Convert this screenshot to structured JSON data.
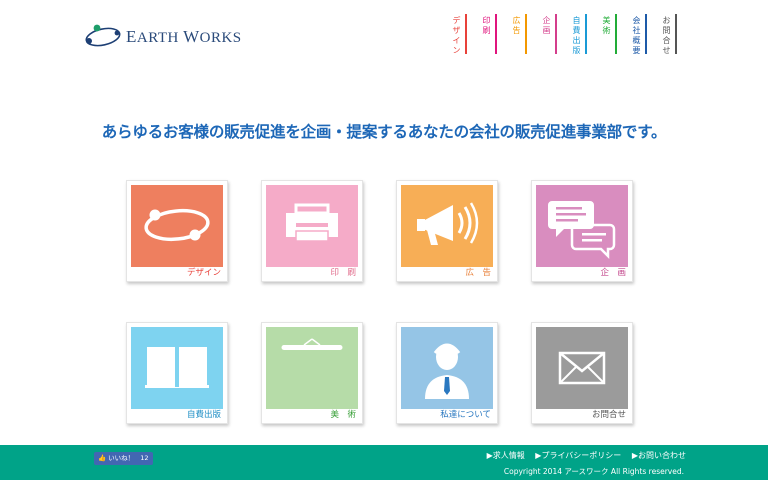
{
  "logo": {
    "big": "E",
    "rest": "ARTH",
    "space": " ",
    "big2": "W",
    "rest2": "ORKS"
  },
  "nav": [
    {
      "label": "デザイン",
      "color": "#e8413a"
    },
    {
      "label": "印刷",
      "color": "#e0157d"
    },
    {
      "label": "広告",
      "color": "#f39800"
    },
    {
      "label": "企画",
      "color": "#d43e8c"
    },
    {
      "label": "自費出版",
      "color": "#1a9ad6"
    },
    {
      "label": "美術",
      "color": "#22ac38"
    },
    {
      "label": "会社概要",
      "color": "#1d5aa8"
    },
    {
      "label": "お問合せ",
      "color": "#555555"
    }
  ],
  "headline": "あらゆるお客様の販売促進を企画・提案するあなたの会社の販売促進事業部です。",
  "cards": [
    {
      "label": "デザイン",
      "bg": "#ee7f5f",
      "color": "#e8413a"
    },
    {
      "label": "印　刷",
      "bg": "#f5abc8",
      "color": "#e06a8a"
    },
    {
      "label": "広　告",
      "bg": "#f7ae56",
      "color": "#e8813a"
    },
    {
      "label": "企　画",
      "bg": "#d98dbf",
      "color": "#c44a8e"
    },
    {
      "label": "自費出版",
      "bg": "#7ed3f0",
      "color": "#1a8cc4"
    },
    {
      "label": "美　術",
      "bg": "#b6dca8",
      "color": "#3aa03a"
    },
    {
      "label": "私達について",
      "bg": "#95c5e6",
      "color": "#2a78c0"
    },
    {
      "label": "お問合せ",
      "bg": "#9b9b9b",
      "color": "#555555"
    }
  ],
  "footer": {
    "like_label": "いいね！",
    "like_count": "12",
    "links": [
      "求人情報",
      "プライバシーポリシー",
      "お問い合わせ"
    ],
    "copyright": "Copyright 2014 アースワーク All Rights reserved."
  }
}
